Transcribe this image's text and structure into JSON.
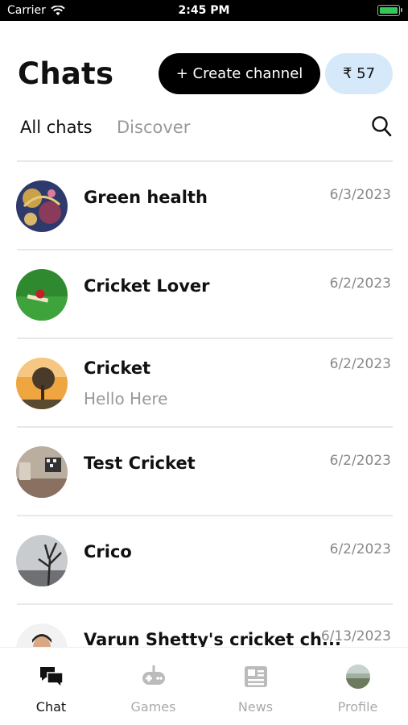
{
  "status_bar": {
    "carrier": "Carrier",
    "time": "2:45 PM"
  },
  "header": {
    "title": "Chats",
    "create_channel_label": "+ Create channel",
    "wallet_balance": "₹ 57"
  },
  "tabs": [
    {
      "label": "All chats",
      "active": true
    },
    {
      "label": "Discover",
      "active": false
    }
  ],
  "chats": [
    {
      "name": "Green health",
      "date": "6/3/2023",
      "preview": ""
    },
    {
      "name": "Cricket Lover",
      "date": "6/2/2023",
      "preview": ""
    },
    {
      "name": "Cricket",
      "date": "6/2/2023",
      "preview": "Hello Here"
    },
    {
      "name": "Test Cricket",
      "date": "6/2/2023",
      "preview": ""
    },
    {
      "name": "Crico",
      "date": "6/2/2023",
      "preview": ""
    },
    {
      "name": "Varun Shetty's cricket ch...",
      "date": "6/13/2023",
      "preview": ""
    }
  ],
  "bottom_nav": [
    {
      "label": "Chat",
      "icon": "chat-bubbles-icon",
      "active": true
    },
    {
      "label": "Games",
      "icon": "gamepad-icon",
      "active": false
    },
    {
      "label": "News",
      "icon": "newspaper-icon",
      "active": false
    },
    {
      "label": "Profile",
      "icon": "profile-avatar-icon",
      "active": false
    }
  ],
  "colors": {
    "accent": "#000000",
    "wallet_bg": "#d6e9fb",
    "muted_text": "#999999"
  }
}
